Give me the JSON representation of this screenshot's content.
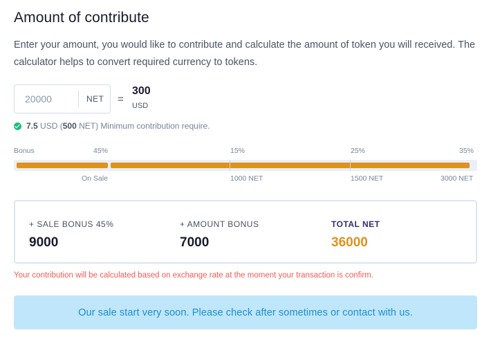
{
  "page": {
    "title": "Amount of contribute",
    "description": "Enter your amount, you would like to contribute and calculate the amount of token you will received. The calculator helps to convert required currency to tokens."
  },
  "calculator": {
    "amount_placeholder": "20000",
    "amount_unit": "NET",
    "equals": "=",
    "result_value": "300",
    "result_unit": "USD"
  },
  "min_contribution": {
    "usd_amount": "7.5",
    "usd_label": "USD",
    "open_paren": "(",
    "net_amount": "500",
    "net_tail": "NET) Minimum contribution require."
  },
  "bonus_progress": {
    "label": "Bonus",
    "fill_fraction": 0.99,
    "stages": [
      {
        "percent": "45%",
        "caption": "On Sale"
      },
      {
        "percent": "15%",
        "caption": "1000 NET"
      },
      {
        "percent": "25%",
        "caption": "1500 NET"
      },
      {
        "percent": "35%",
        "caption": "3000 NET"
      }
    ]
  },
  "summary": {
    "sale_bonus_label": "+ SALE BONUS 45%",
    "sale_bonus_value": "9000",
    "amount_bonus_label": "+ AMOUNT BONUS",
    "amount_bonus_value": "7000",
    "total_label": "TOTAL NET",
    "total_value": "36000"
  },
  "warning_text": "Your contribution will be calculated based on exchange rate at the moment your transaction is confirm.",
  "notice_text": "Our sale start very soon. Please check after sometimes or contact with us.",
  "colors": {
    "accent": "#e0921a",
    "success": "#1bbf7a",
    "warning": "#ef5b57",
    "info_bg": "#bfe6fb",
    "info_text": "#1a8fd0"
  }
}
